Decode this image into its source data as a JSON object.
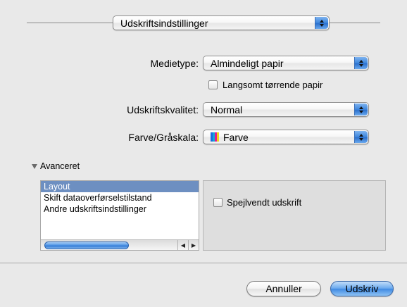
{
  "header": {
    "popup_value": "Udskriftsindstillinger"
  },
  "media": {
    "label": "Medietype:",
    "value": "Almindeligt papir",
    "checkbox_label": "Langsomt tørrende papir",
    "checkbox_checked": false
  },
  "quality": {
    "label": "Udskriftskvalitet:",
    "value": "Normal"
  },
  "color": {
    "label": "Farve/Gråskala:",
    "value": "Farve",
    "swatch_colors": [
      "#1b6ae0",
      "#12a8d8",
      "#e21f8c",
      "#f0d21a"
    ]
  },
  "advanced": {
    "label": "Avanceret",
    "list_items": [
      "Layout",
      "Skift dataoverførselstilstand",
      "Andre udskriftsindstillinger"
    ],
    "selected_index": 0,
    "mirror_label": "Spejlvendt udskrift",
    "mirror_checked": false
  },
  "buttons": {
    "cancel": "Annuller",
    "print": "Udskriv"
  }
}
